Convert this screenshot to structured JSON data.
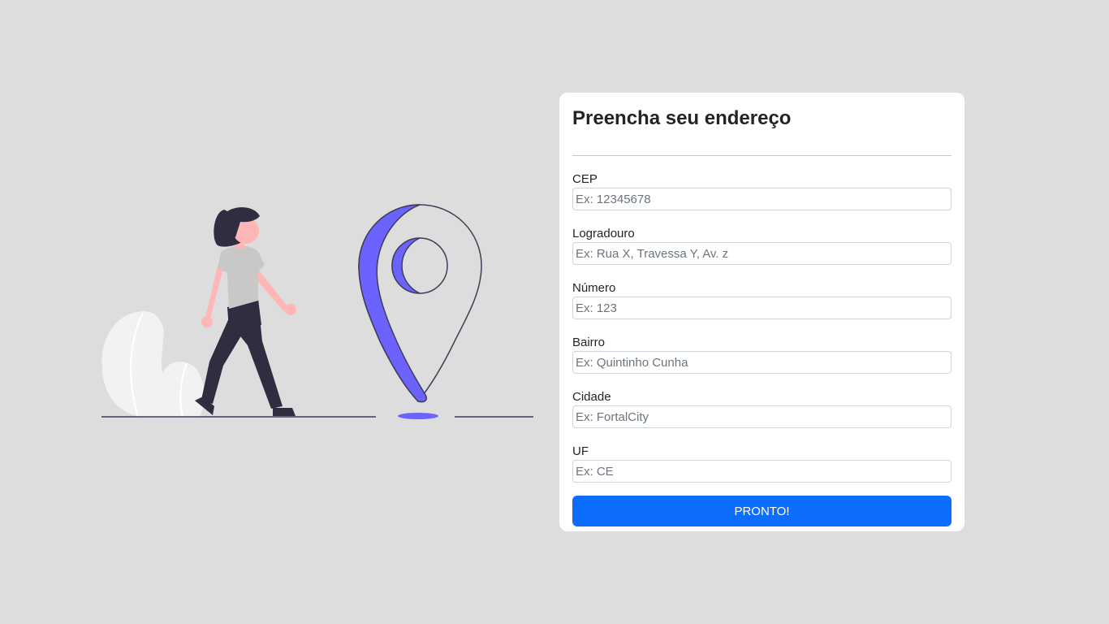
{
  "form": {
    "title": "Preencha seu endereço",
    "fields": [
      {
        "label": "CEP",
        "placeholder": "Ex: 12345678",
        "value": ""
      },
      {
        "label": "Logradouro",
        "placeholder": "Ex: Rua X, Travessa Y, Av. z",
        "value": ""
      },
      {
        "label": "Número",
        "placeholder": "Ex: 123",
        "value": ""
      },
      {
        "label": "Bairro",
        "placeholder": "Ex: Quintinho Cunha",
        "value": ""
      },
      {
        "label": "Cidade",
        "placeholder": "Ex: FortalCity",
        "value": ""
      },
      {
        "label": "UF",
        "placeholder": "Ex: CE",
        "value": ""
      }
    ],
    "submit_label": "PRONTO!"
  },
  "illustration": {
    "name": "woman-walking-to-map-pin",
    "colors": {
      "accent": "#6c63ff",
      "skin": "#ffb6b6",
      "hair": "#2f2e41",
      "shirt": "#c8c8c8",
      "pants": "#2f2e41",
      "foliage": "#f2f2f2",
      "ground": "#3f3d56"
    }
  },
  "colors": {
    "background": "#dddddd",
    "card": "#ffffff",
    "primary": "#0d6efd"
  }
}
